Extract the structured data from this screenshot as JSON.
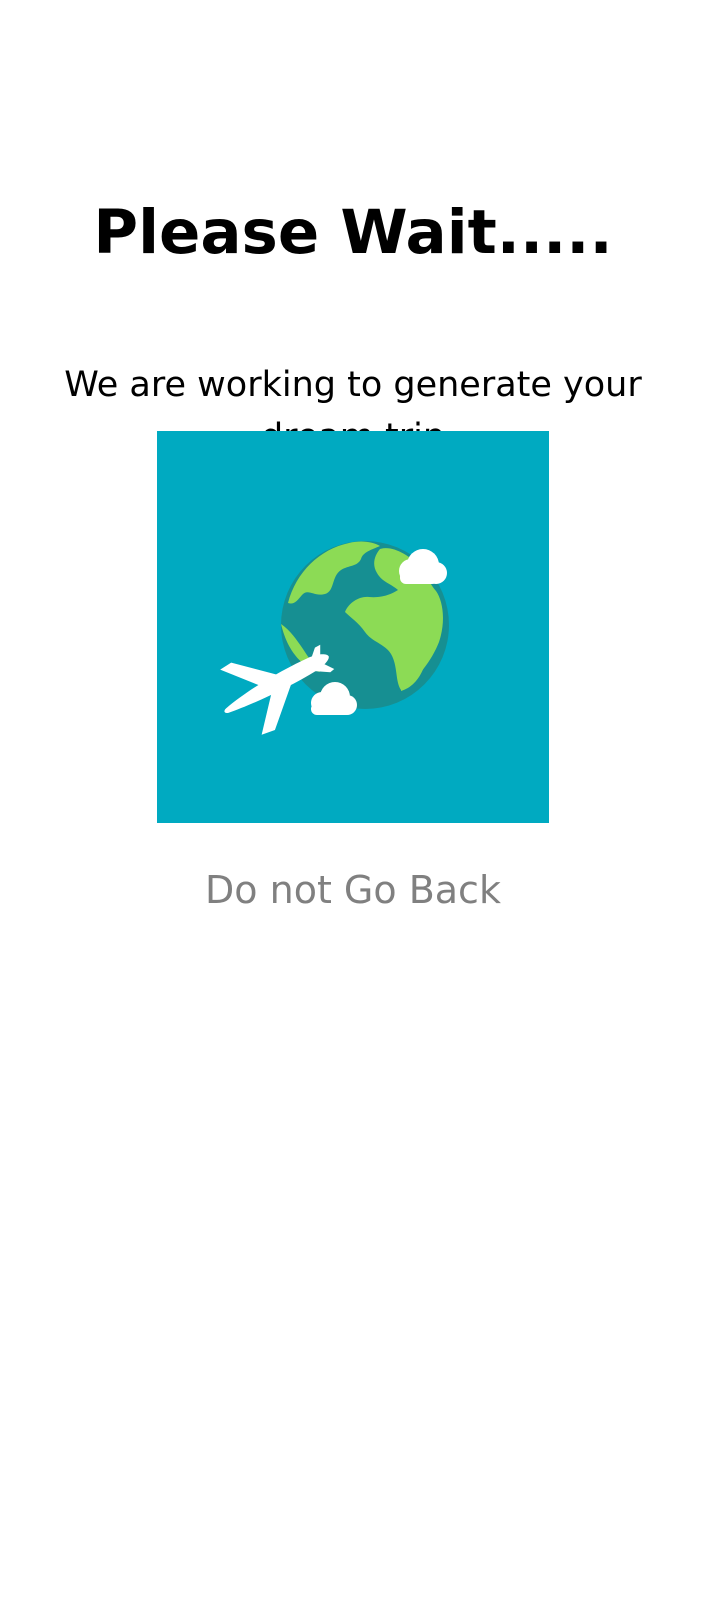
{
  "loading": {
    "title": "Please Wait.....",
    "message": "We are working to generate your dream trip",
    "warning": "Do not Go Back"
  },
  "illustration": {
    "icon": "globe-airplane-icon",
    "background_color": "#00aac1",
    "ocean_color": "#168f92",
    "land_color": "#8cdb55",
    "cloud_color": "#ffffff"
  }
}
